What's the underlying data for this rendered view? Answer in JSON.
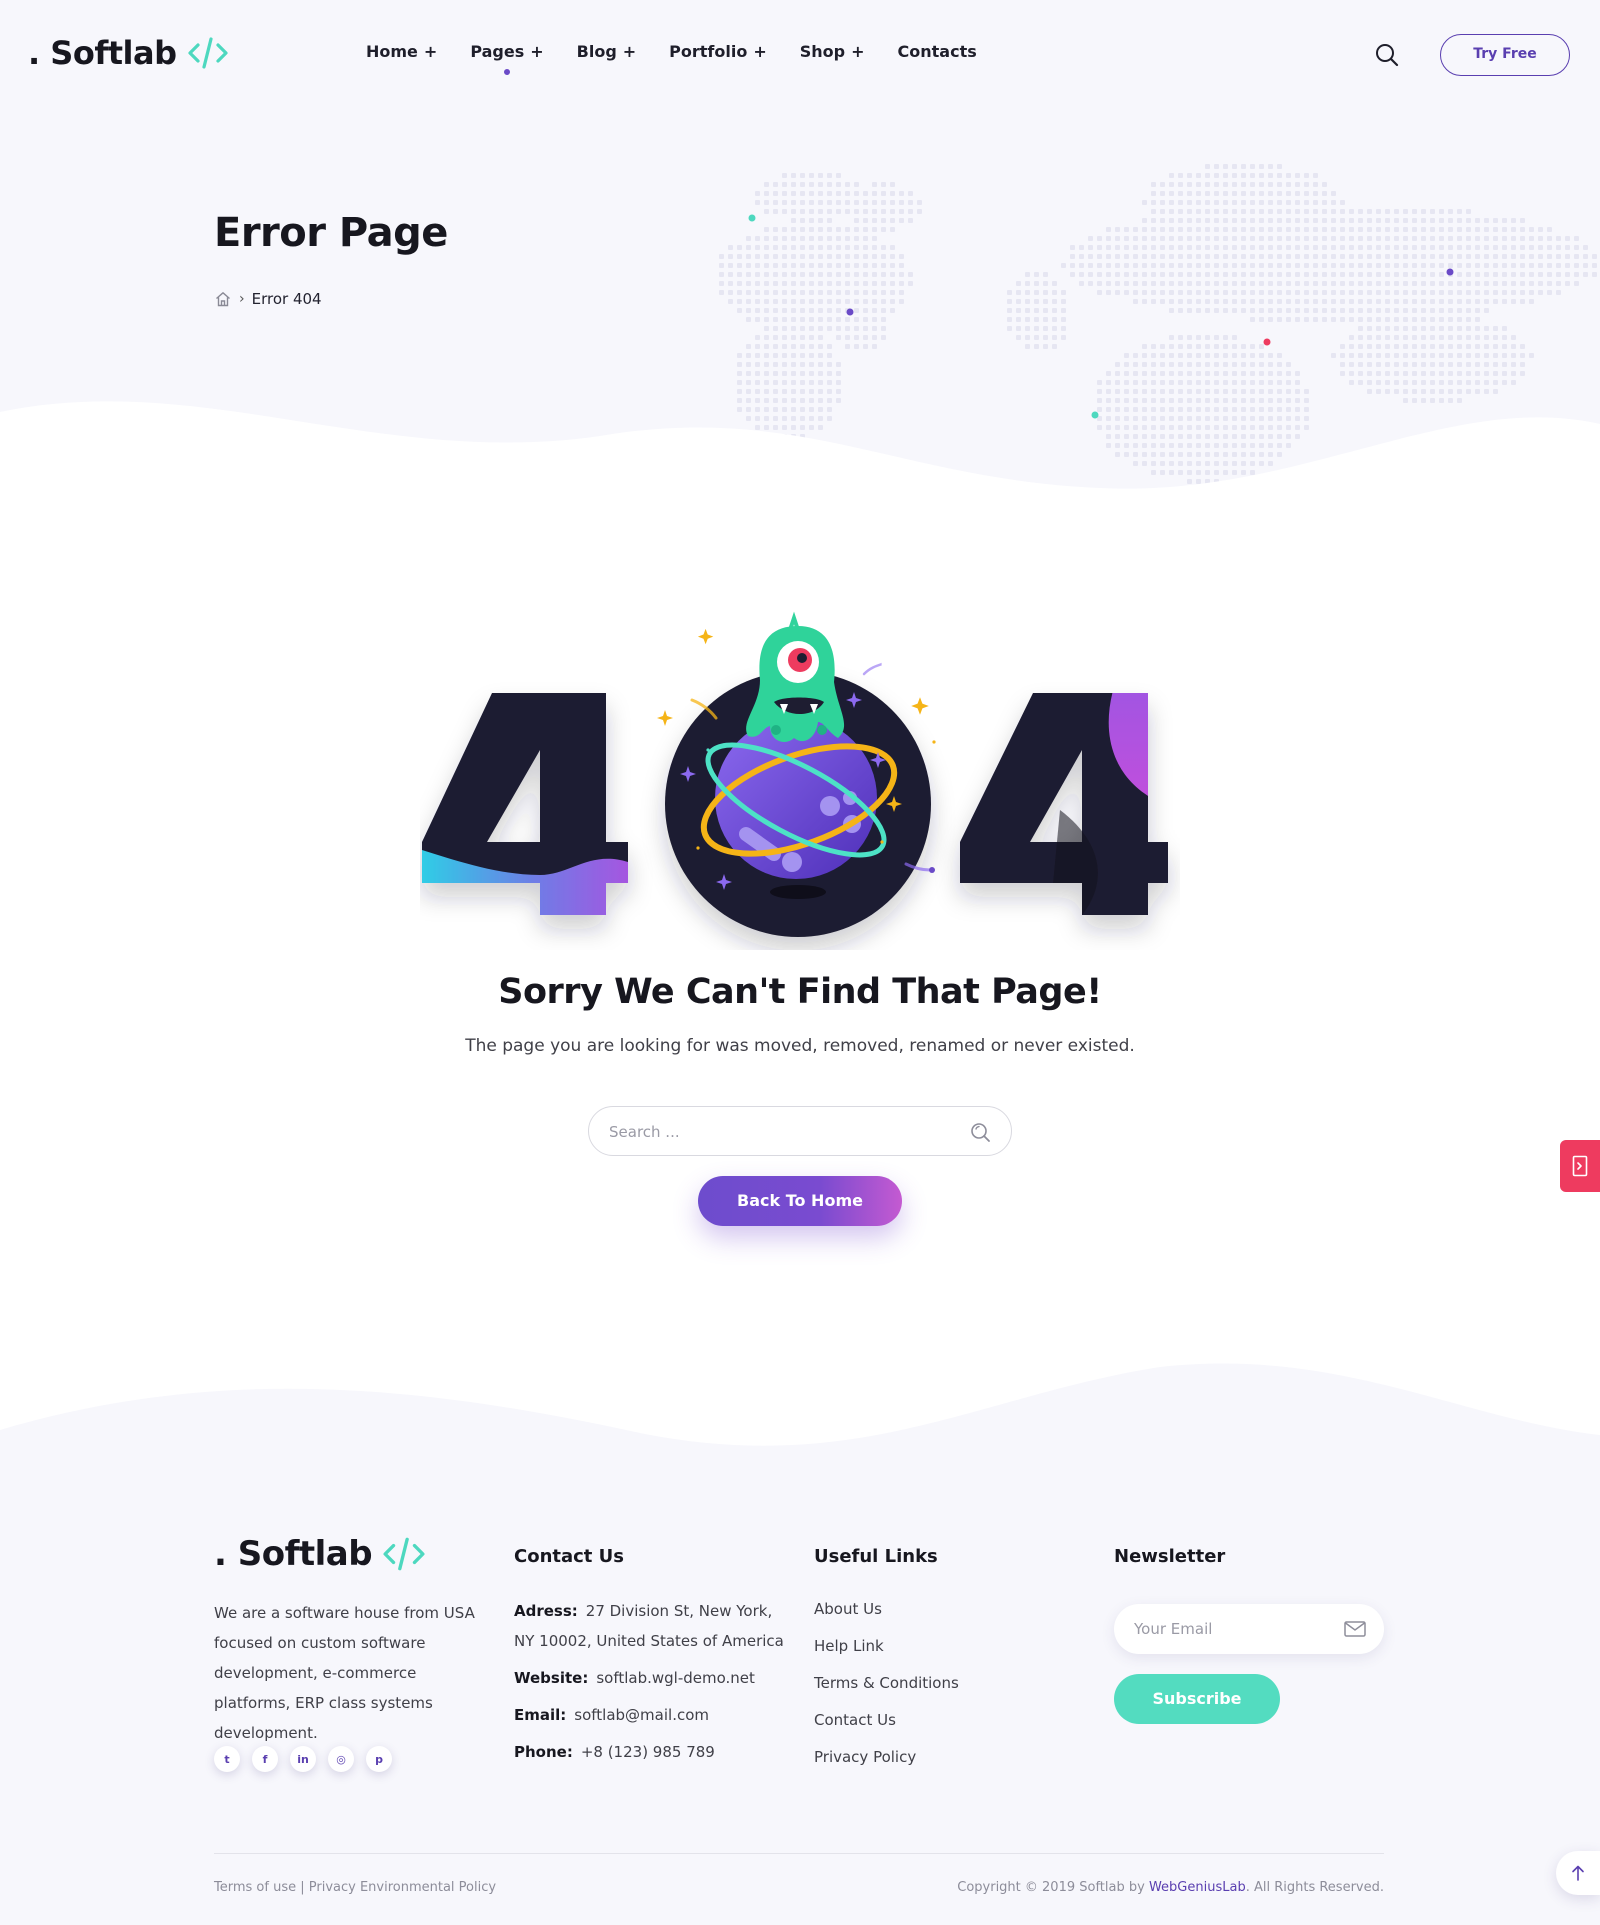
{
  "brand": {
    "name": ". Softlab",
    "mark_color": "#4dd8bf"
  },
  "header": {
    "nav": [
      {
        "label": "Home",
        "has_submenu": true
      },
      {
        "label": "Pages",
        "has_submenu": true,
        "active": true
      },
      {
        "label": "Blog",
        "has_submenu": true
      },
      {
        "label": "Portfolio",
        "has_submenu": true
      },
      {
        "label": "Shop",
        "has_submenu": true
      },
      {
        "label": "Contacts",
        "has_submenu": false
      }
    ],
    "plus_glyph": "+",
    "search_icon": "search-icon",
    "cta_label": "Try Free"
  },
  "hero": {
    "title": "Error Page",
    "breadcrumb": {
      "home_icon": "home-icon",
      "separator": "›",
      "current": "Error 404"
    }
  },
  "error": {
    "title": "Sorry We Can't Find That Page!",
    "message": "The page you are looking for was moved, removed, renamed or never existed.",
    "search_placeholder": "Search ...",
    "back_label": "Back To Home"
  },
  "footer": {
    "about": "We are a software house from USA focused on custom software development, e-commerce platforms, ERP class systems development.",
    "social_icons": [
      {
        "name": "twitter-icon",
        "glyph": "t"
      },
      {
        "name": "facebook-icon",
        "glyph": "f"
      },
      {
        "name": "linkedin-icon",
        "glyph": "in"
      },
      {
        "name": "instagram-icon",
        "glyph": "◎"
      },
      {
        "name": "pinterest-icon",
        "glyph": "p"
      }
    ],
    "contact": {
      "title": "Contact Us",
      "address_label": "Adress:",
      "address": "27 Division St, New York, NY 10002, United States of America",
      "website_label": "Website:",
      "website": "softlab.wgl-demo.net",
      "email_label": "Email:",
      "email": "softlab@mail.com",
      "phone_label": "Phone:",
      "phone": "+8 (123) 985 789"
    },
    "links": {
      "title": "Useful Links",
      "items": [
        "About Us",
        "Help Link",
        "Terms & Conditions",
        "Contact Us",
        "Privacy Policy"
      ]
    },
    "newsletter": {
      "title": "Newsletter",
      "placeholder": "Your Email",
      "button": "Subscribe"
    },
    "bottom": {
      "terms": "Terms of use",
      "sep": " | ",
      "privacy": "Privacy Environmental Policy",
      "copyright_pre": "Copyright © 2019 Softlab by ",
      "copyright_link": "WebGeniusLab",
      "copyright_post": ". All Rights Reserved."
    }
  },
  "colors": {
    "accent": "#5a3fb0",
    "teal": "#53dcc0",
    "dark": "#1e1d31",
    "side_tab": "#ee3b5f"
  }
}
